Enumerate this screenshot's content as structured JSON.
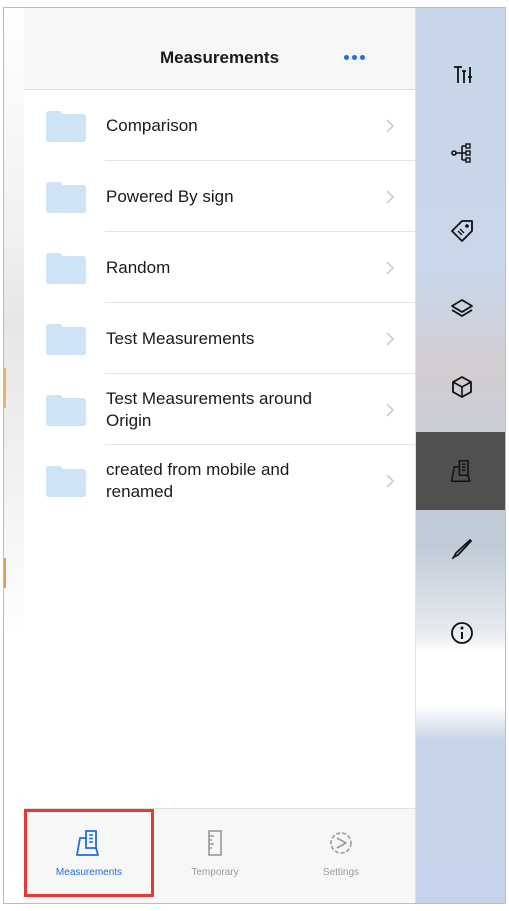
{
  "header": {
    "title": "Measurements"
  },
  "folders": [
    {
      "label": "Comparison"
    },
    {
      "label": "Powered By sign"
    },
    {
      "label": "Random"
    },
    {
      "label": "Test Measurements"
    },
    {
      "label": "Test Measurements around Origin"
    },
    {
      "label": "created from mobile and renamed"
    }
  ],
  "tabs": [
    {
      "label": "Measurements",
      "icon": "measurements-icon",
      "active": true
    },
    {
      "label": "Temporary",
      "icon": "ruler-icon",
      "active": false
    },
    {
      "label": "Settings",
      "icon": "settings-icon",
      "active": false
    }
  ],
  "right_toolbar": [
    {
      "icon": "filter-sort-icon"
    },
    {
      "icon": "tree-icon"
    },
    {
      "icon": "tag-icon"
    },
    {
      "icon": "layers-icon"
    },
    {
      "icon": "cube-icon"
    },
    {
      "icon": "measurements-icon",
      "active": true
    },
    {
      "icon": "pen-icon"
    },
    {
      "icon": "info-icon"
    }
  ],
  "colors": {
    "accent": "#1e6fd9",
    "folder": "#cfe3f7",
    "highlight": "#e53935",
    "toolbar_active": "#505050"
  }
}
